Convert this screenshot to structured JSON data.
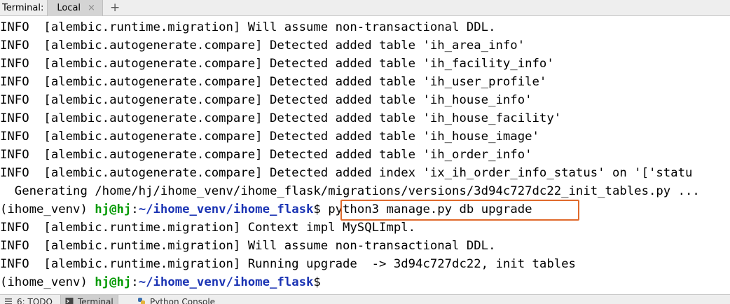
{
  "tool_window": {
    "title": "Terminal:",
    "tabs": [
      {
        "label": "Local",
        "close_icon": "×"
      }
    ],
    "add_icon": "+"
  },
  "terminal": {
    "lines": [
      {
        "text": "INFO  [alembic.runtime.migration] Will assume non-transactional DDL."
      },
      {
        "text": "INFO  [alembic.autogenerate.compare] Detected added table 'ih_area_info'"
      },
      {
        "text": "INFO  [alembic.autogenerate.compare] Detected added table 'ih_facility_info'"
      },
      {
        "text": "INFO  [alembic.autogenerate.compare] Detected added table 'ih_user_profile'"
      },
      {
        "text": "INFO  [alembic.autogenerate.compare] Detected added table 'ih_house_info'"
      },
      {
        "text": "INFO  [alembic.autogenerate.compare] Detected added table 'ih_house_facility'"
      },
      {
        "text": "INFO  [alembic.autogenerate.compare] Detected added table 'ih_house_image'"
      },
      {
        "text": "INFO  [alembic.autogenerate.compare] Detected added table 'ih_order_info'"
      },
      {
        "text": "INFO  [alembic.autogenerate.compare] Detected added index 'ix_ih_order_info_status' on '['statu"
      },
      {
        "text": "  Generating /home/hj/ihome_venv/ihome_flask/migrations/versions/3d94c727dc22_init_tables.py ..."
      }
    ],
    "prompt1": {
      "env": "(ihome_venv) ",
      "user": "hj@hj",
      "colon": ":",
      "path": "~/ihome_venv/ihome_flask",
      "dollar": "$",
      "command": " python3 manage.py db upgrade"
    },
    "lines2": [
      {
        "text": "INFO  [alembic.runtime.migration] Context impl MySQLImpl."
      },
      {
        "text": "INFO  [alembic.runtime.migration] Will assume non-transactional DDL."
      },
      {
        "text": "INFO  [alembic.runtime.migration] Running upgrade  -> 3d94c727dc22, init tables"
      }
    ],
    "prompt2": {
      "env": "(ihome_venv) ",
      "user": "hj@hj",
      "colon": ":",
      "path": "~/ihome_venv/ihome_flask",
      "dollar": "$"
    },
    "colors": {
      "user": "#009900",
      "path": "#1a33b3",
      "highlight": "#e06a2c"
    }
  },
  "bottom_tabs": [
    {
      "label": "6: TODO",
      "icon": "todo-icon"
    },
    {
      "label": "Terminal",
      "icon": "terminal-icon"
    },
    {
      "label": "Python Console",
      "icon": "python-icon"
    }
  ]
}
